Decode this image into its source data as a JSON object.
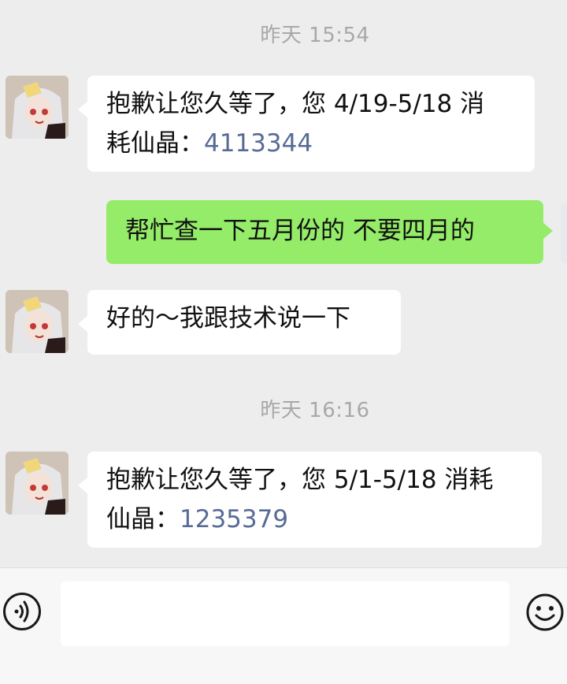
{
  "messages": [
    {
      "type": "timestamp",
      "text": "昨天 15:54"
    },
    {
      "type": "incoming",
      "text": "抱歉让您久等了，您 4/19-5/18 消",
      "text2": "耗仙晶：",
      "number": "4113344"
    },
    {
      "type": "outgoing",
      "text": "帮忙查一下五月份的 不要四月的"
    },
    {
      "type": "incoming",
      "text": "好的～我跟技术说一下"
    },
    {
      "type": "timestamp",
      "text": "昨天 16:16"
    },
    {
      "type": "incoming",
      "text": "抱歉让您久等了，您 5/1-5/18 消耗",
      "text2": "仙晶：",
      "number": "1235379"
    }
  ],
  "input_bar": {
    "voice_icon": "voice-icon",
    "text_value": "",
    "emoji_icon": "emoji-icon"
  },
  "colors": {
    "background": "#ededed",
    "incoming_bubble": "#ffffff",
    "outgoing_bubble": "#95ec69",
    "number_link": "#576b95",
    "timestamp": "#a8a8a8"
  }
}
